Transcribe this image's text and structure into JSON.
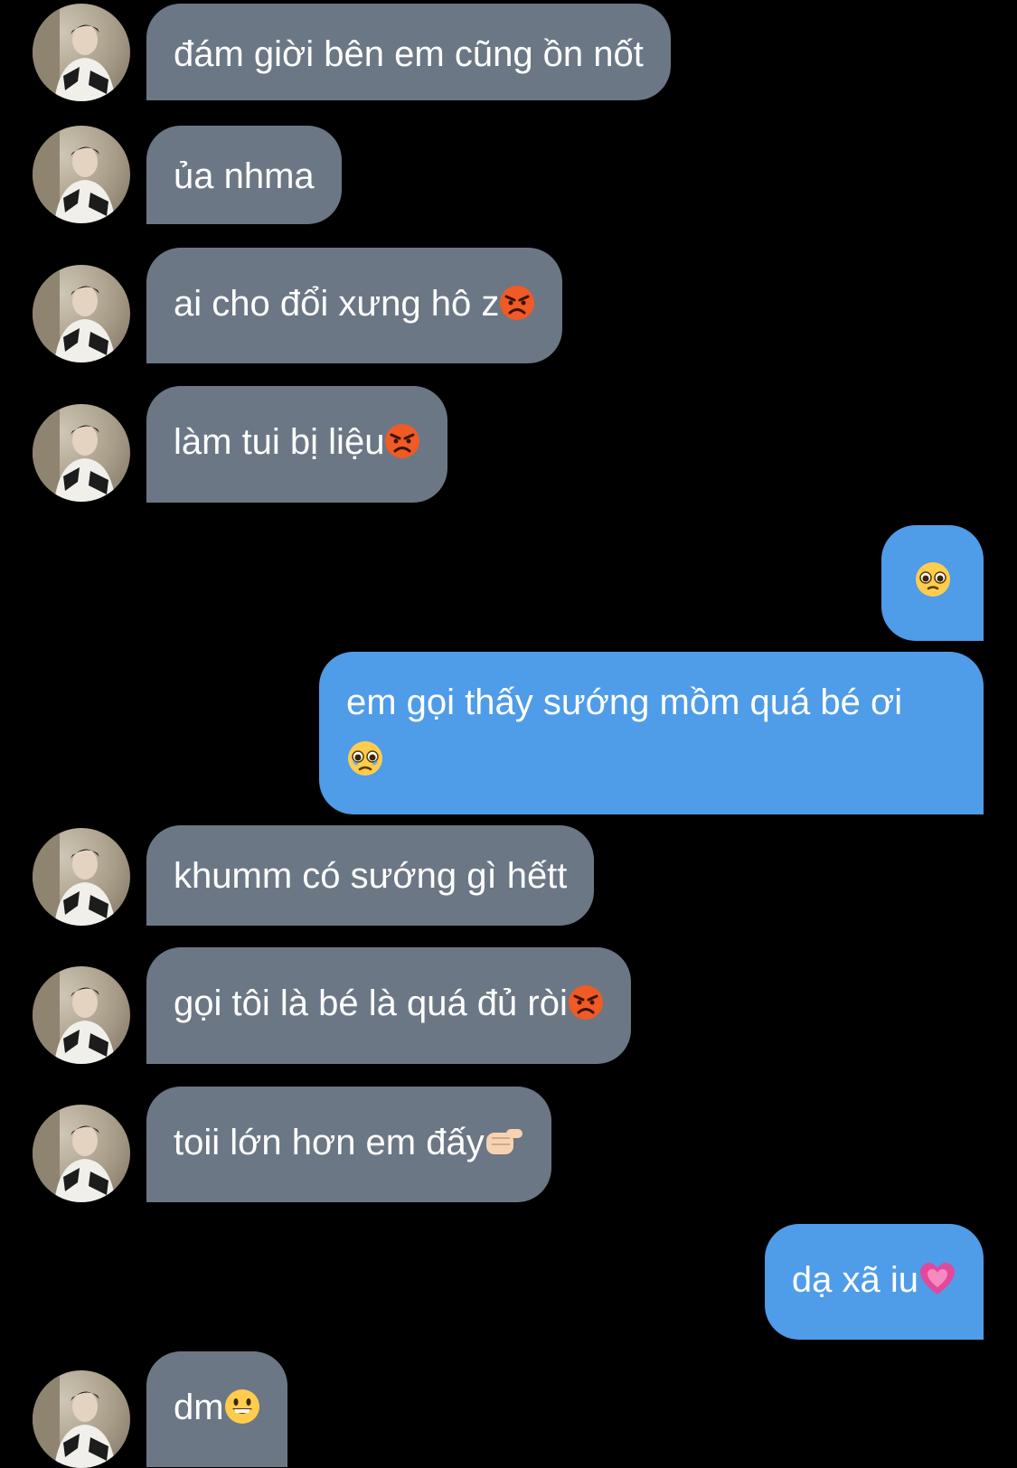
{
  "conversation": {
    "messages": [
      {
        "from": "them",
        "text": "đám giời bên em cũng ồn nốt"
      },
      {
        "from": "them",
        "text": "ủa nhma"
      },
      {
        "from": "them",
        "text": "ai cho đổi xưng hô z",
        "emoji": "angry-face"
      },
      {
        "from": "them",
        "text": "làm tui bị liệu",
        "emoji": "angry-face"
      },
      {
        "from": "me",
        "text": "",
        "emoji": "pleading-face"
      },
      {
        "from": "me",
        "text": "em gọi thấy sướng mồm quá bé ơi",
        "emoji": "face-holding-back-tears"
      },
      {
        "from": "them",
        "text": "khumm có sướng gì hếtt"
      },
      {
        "from": "them",
        "text": "gọi tôi là bé là quá đủ ròi",
        "emoji": "angry-face"
      },
      {
        "from": "them",
        "text": "toii lớn hơn em đấy",
        "emoji": "pointing-fist"
      },
      {
        "from": "me",
        "text": "dạ xã iu",
        "emoji": "growing-heart"
      },
      {
        "from": "them",
        "text": "dm",
        "emoji": "grinning-face"
      }
    ]
  },
  "colors": {
    "background": "#000000",
    "incoming_bubble": "#6b7784",
    "outgoing_bubble": "#4f9ce8",
    "text": "#ffffff"
  }
}
